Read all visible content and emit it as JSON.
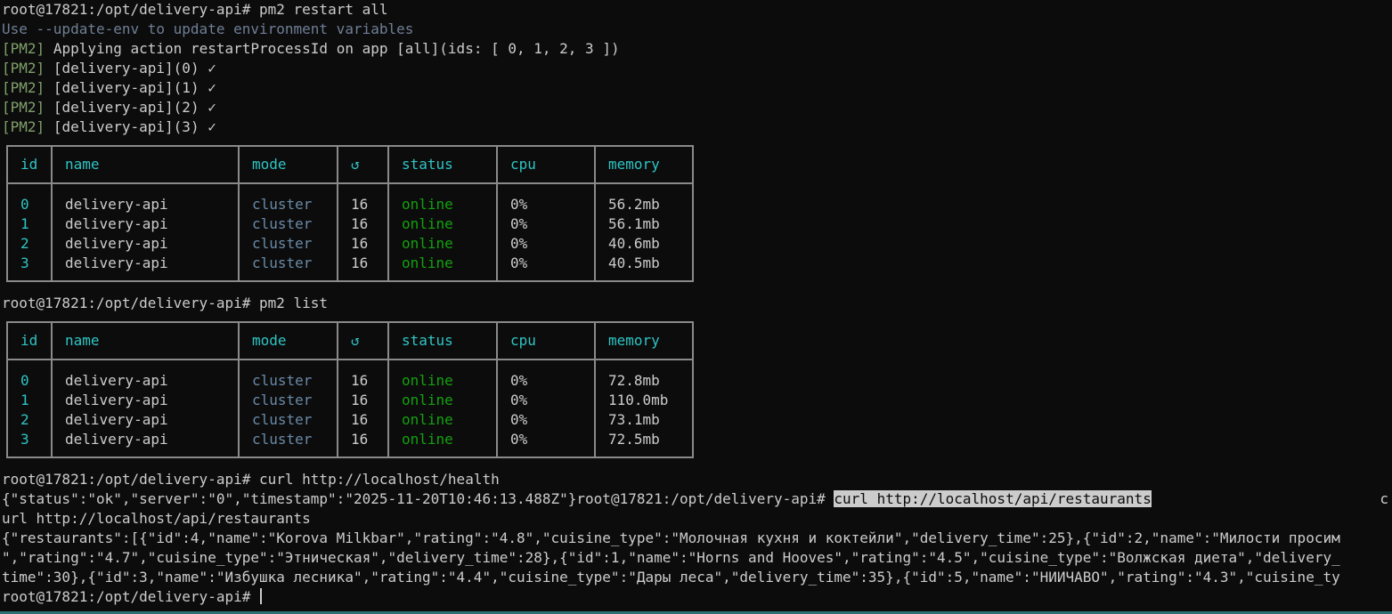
{
  "prompt": "root@17821:/opt/delivery-api#",
  "commands": {
    "restart": "pm2 restart all",
    "list": "pm2 list",
    "health": "curl http://localhost/health",
    "restaurants": "curl http://localhost/api/restaurants"
  },
  "restart_output": {
    "hint": "Use --update-env to update environment variables",
    "tag": "[PM2]",
    "applying": "Applying action restartProcessId on app [all](ids: [ 0, 1, 2, 3 ])",
    "done": [
      "[delivery-api](0) ✓",
      "[delivery-api](1) ✓",
      "[delivery-api](2) ✓",
      "[delivery-api](3) ✓"
    ]
  },
  "table_headers": [
    "id",
    "name",
    "mode",
    "↺",
    "status",
    "cpu",
    "memory"
  ],
  "table1": [
    {
      "id": "0",
      "name": "delivery-api",
      "mode": "cluster",
      "restarts": "16",
      "status": "online",
      "cpu": "0%",
      "memory": "56.2mb"
    },
    {
      "id": "1",
      "name": "delivery-api",
      "mode": "cluster",
      "restarts": "16",
      "status": "online",
      "cpu": "0%",
      "memory": "56.1mb"
    },
    {
      "id": "2",
      "name": "delivery-api",
      "mode": "cluster",
      "restarts": "16",
      "status": "online",
      "cpu": "0%",
      "memory": "40.6mb"
    },
    {
      "id": "3",
      "name": "delivery-api",
      "mode": "cluster",
      "restarts": "16",
      "status": "online",
      "cpu": "0%",
      "memory": "40.5mb"
    }
  ],
  "table2": [
    {
      "id": "0",
      "name": "delivery-api",
      "mode": "cluster",
      "restarts": "16",
      "status": "online",
      "cpu": "0%",
      "memory": "72.8mb"
    },
    {
      "id": "1",
      "name": "delivery-api",
      "mode": "cluster",
      "restarts": "16",
      "status": "online",
      "cpu": "0%",
      "memory": "110.0mb"
    },
    {
      "id": "2",
      "name": "delivery-api",
      "mode": "cluster",
      "restarts": "16",
      "status": "online",
      "cpu": "0%",
      "memory": "73.1mb"
    },
    {
      "id": "3",
      "name": "delivery-api",
      "mode": "cluster",
      "restarts": "16",
      "status": "online",
      "cpu": "0%",
      "memory": "72.5mb"
    }
  ],
  "health_output": "{\"status\":\"ok\",\"server\":\"0\",\"timestamp\":\"2025-11-20T10:46:13.488Z\"}",
  "wrap_tail": "c",
  "wrapped_command": "url http://localhost/api/restaurants",
  "restaurants_lines": [
    "{\"restaurants\":[{\"id\":4,\"name\":\"Korova Milkbar\",\"rating\":\"4.8\",\"cuisine_type\":\"Молочная кухня и коктейли\",\"delivery_time\":25},{\"id\":2,\"name\":\"Милости просим",
    "\",\"rating\":\"4.7\",\"cuisine_type\":\"Этническая\",\"delivery_time\":28},{\"id\":1,\"name\":\"Horns and Hooves\",\"rating\":\"4.5\",\"cuisine_type\":\"Волжская диета\",\"delivery_",
    "time\":30},{\"id\":3,\"name\":\"Избушка лесника\",\"rating\":\"4.4\",\"cuisine_type\":\"Дары леса\",\"delivery_time\":35},{\"id\":5,\"name\":\"НИИЧАВО\",\"rating\":\"4.3\",\"cuisine_ty"
  ],
  "colors": {
    "background": "#0c0c0c",
    "text": "#cccccc",
    "header": "#2fc4c4",
    "online": "#13a10e",
    "pm2_tag": "#7fa06a",
    "border": "#8a8a8a"
  }
}
